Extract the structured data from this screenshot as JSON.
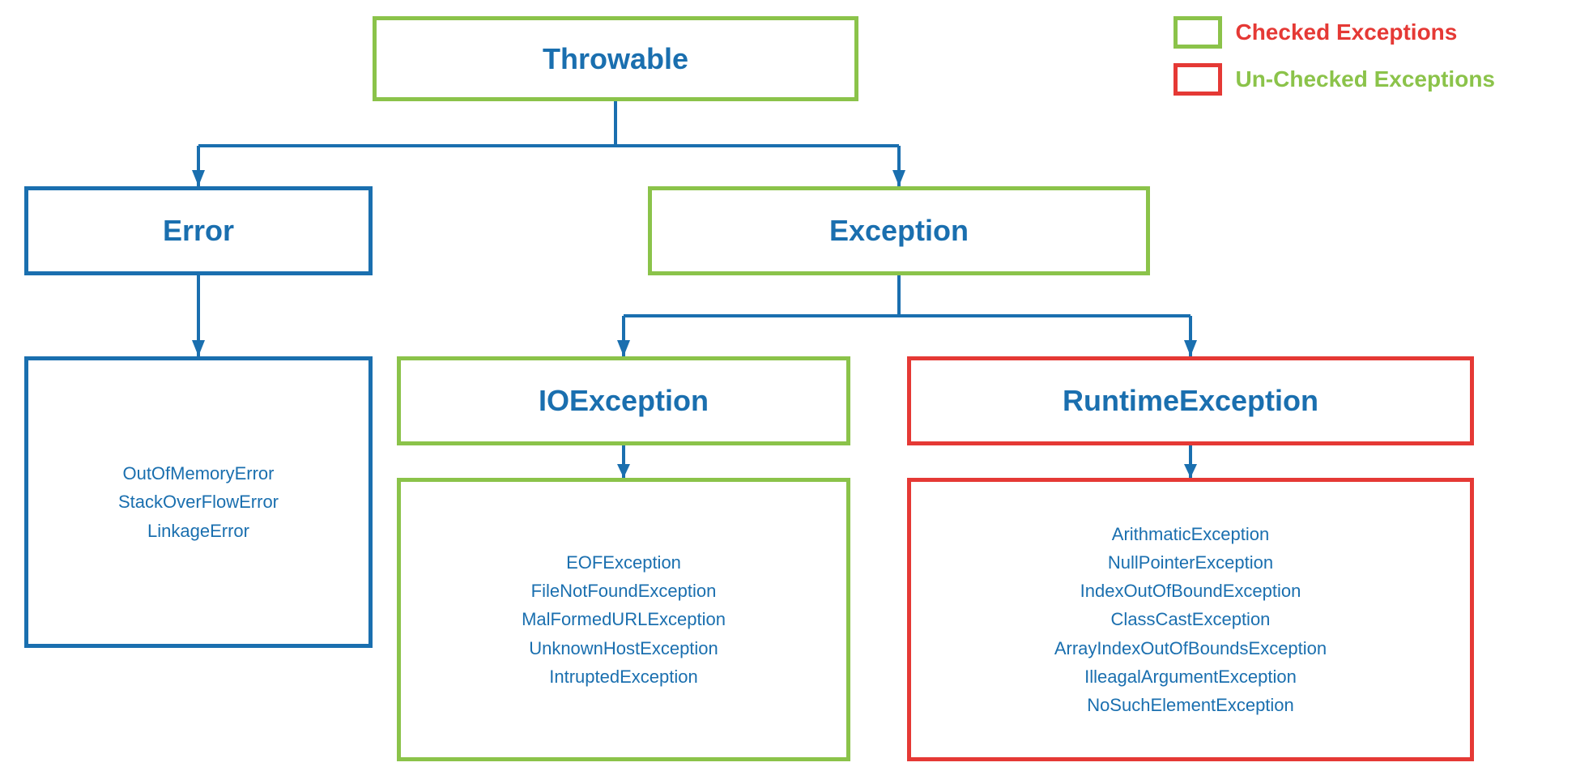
{
  "legend": {
    "checked_label": "Checked Exceptions",
    "unchecked_label": "Un-Checked Exceptions"
  },
  "nodes": {
    "throwable": {
      "label": "Throwable",
      "border": "green"
    },
    "error": {
      "label": "Error",
      "border": "blue",
      "children": [
        "OutOfMemoryError",
        "StackOverFlowError",
        "LinkageError"
      ]
    },
    "exception": {
      "label": "Exception",
      "border": "green"
    },
    "ioexception": {
      "label": "IOException",
      "border": "green",
      "children": [
        "EOFException",
        "FileNotFoundException",
        "MalFormedURLException",
        "UnknownHostException",
        "IntruptedException"
      ]
    },
    "runtimeexception": {
      "label": "RuntimeException",
      "border": "red",
      "children": [
        "ArithmaticException",
        "NullPointerException",
        "IndexOutOfBoundException",
        "ClassCastException",
        "ArrayIndexOutOfBoundsException",
        "IlleagalArgumentException",
        "NoSuchElementException"
      ]
    }
  }
}
